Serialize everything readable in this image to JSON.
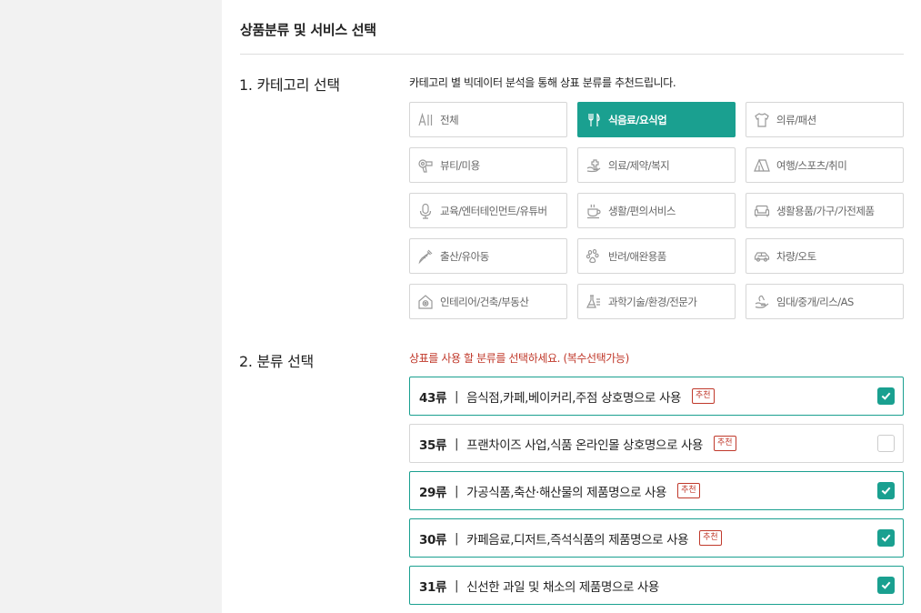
{
  "header": {
    "title": "상품분류 및 서비스 선택"
  },
  "step1": {
    "label": "1. 카테고리 선택",
    "description": "카테고리 별 빅데이터 분석을 통해 상표 분류를 추천드립니다.",
    "categories": [
      {
        "label": "전체",
        "icon": "all-icon",
        "active": false
      },
      {
        "label": "식음료/요식업",
        "icon": "fork-knife-icon",
        "active": true
      },
      {
        "label": "의류/패션",
        "icon": "tshirt-icon",
        "active": false
      },
      {
        "label": "뷰티/미용",
        "icon": "hair-dryer-icon",
        "active": false
      },
      {
        "label": "의료/제약/복지",
        "icon": "medical-hand-icon",
        "active": false
      },
      {
        "label": "여행/스포츠/취미",
        "icon": "tent-icon",
        "active": false
      },
      {
        "label": "교육/엔터테인먼트/유튜버",
        "icon": "microphone-icon",
        "active": false
      },
      {
        "label": "생활/편의서비스",
        "icon": "coffee-cup-icon",
        "active": false
      },
      {
        "label": "생활용품/가구/가전제품",
        "icon": "sofa-icon",
        "active": false
      },
      {
        "label": "출산/유아동",
        "icon": "baby-bottle-icon",
        "active": false
      },
      {
        "label": "반려/애완용품",
        "icon": "paw-icon",
        "active": false
      },
      {
        "label": "차량/오토",
        "icon": "car-icon",
        "active": false
      },
      {
        "label": "인테리어/건축/부동산",
        "icon": "house-icon",
        "active": false
      },
      {
        "label": "과학기술/환경/전문가",
        "icon": "science-icon",
        "active": false
      },
      {
        "label": "임대/중개/리스/AS",
        "icon": "hand-service-icon",
        "active": false
      }
    ]
  },
  "step2": {
    "label": "2. 분류 선택",
    "instruction": "상표를 사용 할 분류를 선택하세요. (복수선택가능)",
    "classes": [
      {
        "code": "43류",
        "separator": "|",
        "desc": "음식점,카페,베이커리,주점 상호명으로 사용",
        "badge": "추천",
        "checked": true
      },
      {
        "code": "35류",
        "separator": "|",
        "desc": "프랜차이즈 사업,식품 온라인몰 상호명으로 사용",
        "badge": "추천",
        "checked": false
      },
      {
        "code": "29류",
        "separator": "|",
        "desc": "가공식품,축산·해산물의 제품명으로 사용",
        "badge": "추천",
        "checked": true
      },
      {
        "code": "30류",
        "separator": "|",
        "desc": "카페음료,디저트,즉석식품의 제품명으로 사용",
        "badge": "추천",
        "checked": true
      },
      {
        "code": "31류",
        "separator": "|",
        "desc": "신선한 과일 및 채소의 제품명으로 사용",
        "badge": "",
        "checked": true
      }
    ]
  },
  "colors": {
    "accent": "#1aa090",
    "recommend": "#c0392b",
    "border": "#d6d6d6"
  }
}
